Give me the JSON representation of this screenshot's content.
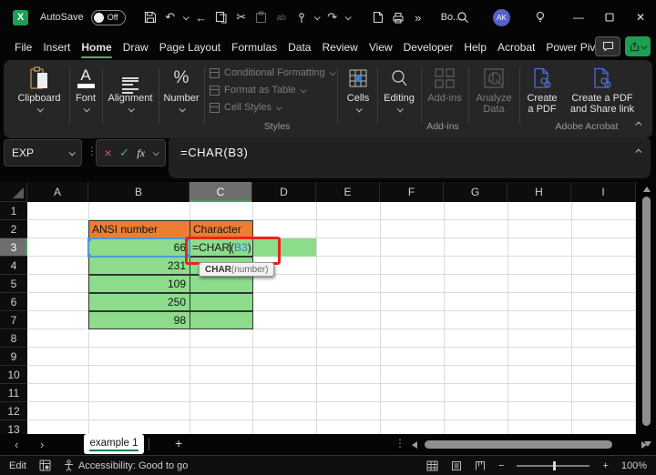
{
  "titlebar": {
    "autosave_label": "AutoSave",
    "autosave_state": "Off",
    "doc_title": "Bo...",
    "avatar_initials": "AK",
    "minimize": "—",
    "close": "✕"
  },
  "menu": {
    "items": [
      "File",
      "Insert",
      "Home",
      "Draw",
      "Page Layout",
      "Formulas",
      "Data",
      "Review",
      "View",
      "Developer",
      "Help",
      "Acrobat",
      "Power Pivot"
    ],
    "active": "Home"
  },
  "ribbon": {
    "clipboard": "Clipboard",
    "font": "Font",
    "alignment": "Alignment",
    "number": "Number",
    "styles_items": [
      "Conditional Formatting",
      "Format as Table",
      "Cell Styles"
    ],
    "styles_label": "Styles",
    "cells": "Cells",
    "editing": "Editing",
    "addins_button": "Add-ins",
    "addins_group_label": "Add-ins",
    "analyze_line1": "Analyze",
    "analyze_line2": "Data",
    "pdf1_line1": "Create",
    "pdf1_line2": "a PDF",
    "pdf2_line1": "Create a PDF",
    "pdf2_line2": "and Share link",
    "acrobat_group_label": "Adobe Acrobat",
    "percent_glyph": "%",
    "font_glyph": "A"
  },
  "formula_bar": {
    "name_box": "EXP",
    "cancel_glyph": "×",
    "enter_glyph": "✓",
    "fx_glyph": "fx",
    "formula": "=CHAR(B3)"
  },
  "grid": {
    "cols": [
      "A",
      "B",
      "C",
      "D",
      "E",
      "F",
      "G",
      "H",
      "I"
    ],
    "rows": [
      "1",
      "2",
      "3",
      "4",
      "5",
      "6",
      "7",
      "8",
      "9",
      "10",
      "11",
      "12",
      "13"
    ],
    "selected_column": "C",
    "selected_row": "3",
    "header_b": "ANSI number",
    "header_c": "Character",
    "values": [
      "66",
      "231",
      "109",
      "250",
      "98"
    ],
    "edit_prefix": "=CHAR",
    "edit_paren": "(",
    "edit_ref": "B3",
    "edit_suffix": ")",
    "tooltip_fn": "CHAR",
    "tooltip_args": "(number)"
  },
  "sheet_tabs": {
    "active_tab": "example 1",
    "prev_glyph": "‹",
    "next_glyph": "›",
    "add_glyph": "+",
    "dots_glyph": "⋮"
  },
  "status_bar": {
    "mode": "Edit",
    "accessibility": "Accessibility: Good to go",
    "zoom_out": "−",
    "zoom_in": "+",
    "zoom_level": "100%"
  },
  "qat": {
    "undo_glyph": "↶",
    "redo_glyph": "↷",
    "back_glyph": "←",
    "cut_glyph": "✂",
    "overflow_glyph": "»",
    "replace_glyph": "ab"
  },
  "colors": {
    "accent_green": "#1E9E53",
    "cell_orange": "#ED7D31",
    "cell_green": "#8CDC8C",
    "annotation_red": "#E8251D",
    "reference_blue": "#4a9ad5",
    "formula_ref_text": "#3a7ad1"
  }
}
